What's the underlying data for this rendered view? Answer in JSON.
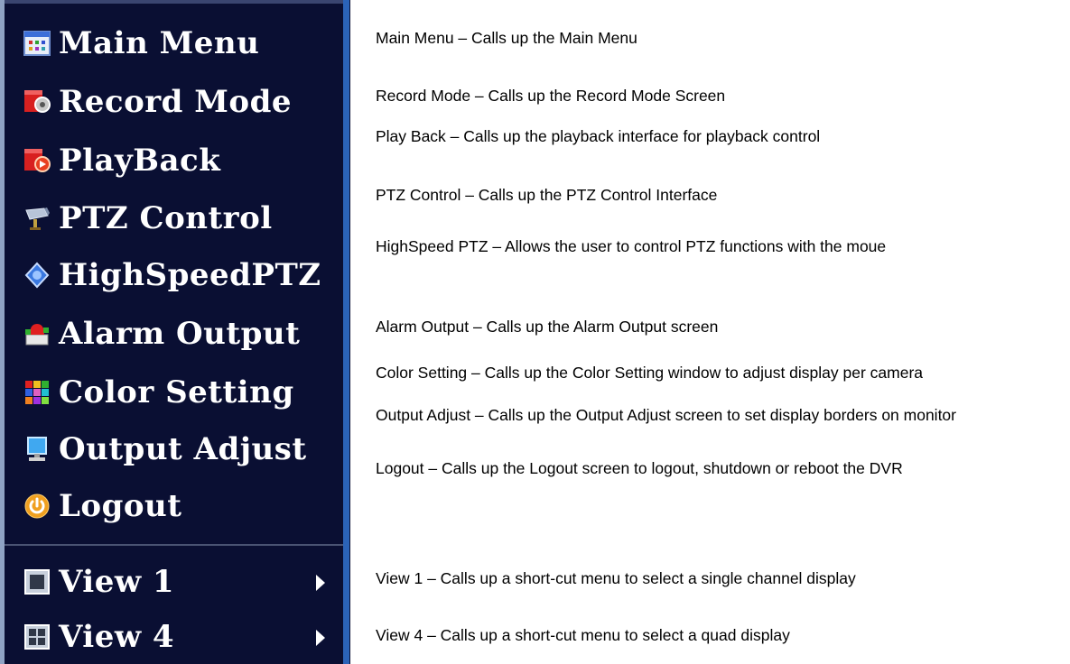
{
  "menu": {
    "items": [
      {
        "label": "Main Menu",
        "icon": "main-menu-icon"
      },
      {
        "label": "Record Mode",
        "icon": "record-mode-icon"
      },
      {
        "label": "PlayBack",
        "icon": "playback-icon"
      },
      {
        "label": "PTZ Control",
        "icon": "ptz-camera-icon"
      },
      {
        "label": "HighSpeedPTZ",
        "icon": "highspeed-ptz-icon"
      },
      {
        "label": "Alarm Output",
        "icon": "alarm-output-icon"
      },
      {
        "label": "Color Setting",
        "icon": "color-setting-icon"
      },
      {
        "label": "Output Adjust",
        "icon": "monitor-icon"
      },
      {
        "label": "Logout",
        "icon": "power-icon"
      },
      {
        "label": "View 1",
        "icon": "single-view-icon",
        "submenu": true
      },
      {
        "label": "View 4",
        "icon": "quad-view-icon",
        "submenu": true
      }
    ]
  },
  "descriptions": [
    "Main Menu – Calls up the Main Menu",
    "Record Mode – Calls up the Record Mode Screen",
    "Play Back – Calls up the playback interface for playback control",
    "PTZ Control – Calls up the PTZ Control Interface",
    "HighSpeed PTZ – Allows the user to control PTZ functions with the moue",
    "Alarm Output – Calls up the Alarm Output screen",
    "Color Setting – Calls up the Color Setting window to adjust display per camera",
    "Output Adjust – Calls up the Output Adjust screen to set display borders on monitor",
    "Logout – Calls up the Logout screen to logout, shutdown or reboot the DVR",
    "View 1 – Calls up a short-cut menu to select a single channel display",
    "View 4 – Calls up a short-cut menu to select a quad display"
  ],
  "colors": {
    "menu_background": "#0a0f33",
    "menu_right_edge": "#2b63b8",
    "menu_text": "#ffffff",
    "description_text": "#000000"
  }
}
